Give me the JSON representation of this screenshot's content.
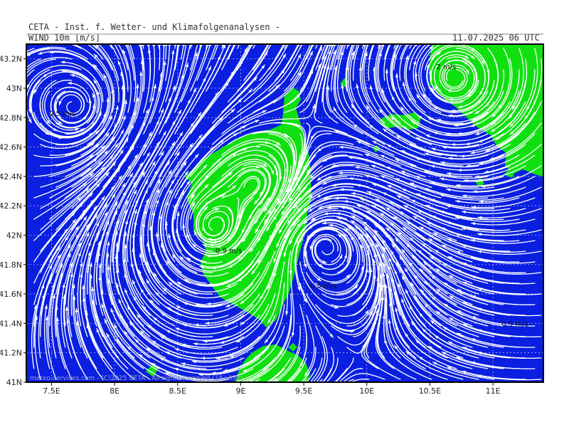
{
  "header": {
    "title": "CETA - Inst. f. Wetter- und Klimafolgenanalysen -",
    "parameter": "WIND 10m [m/s]",
    "valid_time": "11.07.2025 06 UTC"
  },
  "map": {
    "lon_range": [
      7.3,
      11.4
    ],
    "lat_range": [
      41.0,
      43.3
    ],
    "lon_ticks": [
      "7.5E",
      "8E",
      "8.5E",
      "9E",
      "9.5E",
      "10E",
      "10.5E",
      "11E"
    ],
    "lat_ticks": [
      "43.2N",
      "43N",
      "42.8N",
      "42.6N",
      "42.4N",
      "42.2N",
      "42N",
      "41.8N",
      "41.6N",
      "41.4N",
      "41.2N",
      "41N"
    ],
    "colors": {
      "sea": "#0a1fe0",
      "land": "#10e010",
      "streamline": "#ffffff",
      "grid": "#aab4ff",
      "frame": "#000000"
    },
    "annotations": [
      {
        "text": "0.5 m/s",
        "lon": 7.48,
        "lat": 42.81
      },
      {
        "text": "2 m/s",
        "lon": 10.55,
        "lat": 43.13
      },
      {
        "text": "0.5 m/s",
        "lon": 9.55,
        "lat": 41.64
      },
      {
        "text": "0.5 m/s",
        "lon": 11.07,
        "lat": 41.38
      },
      {
        "text": "0.9 m/s",
        "lon": 8.8,
        "lat": 41.88
      }
    ],
    "credit": "meteo-services.com  -  (C)2025 CETA  -  All rights reserved (18+038)"
  }
}
